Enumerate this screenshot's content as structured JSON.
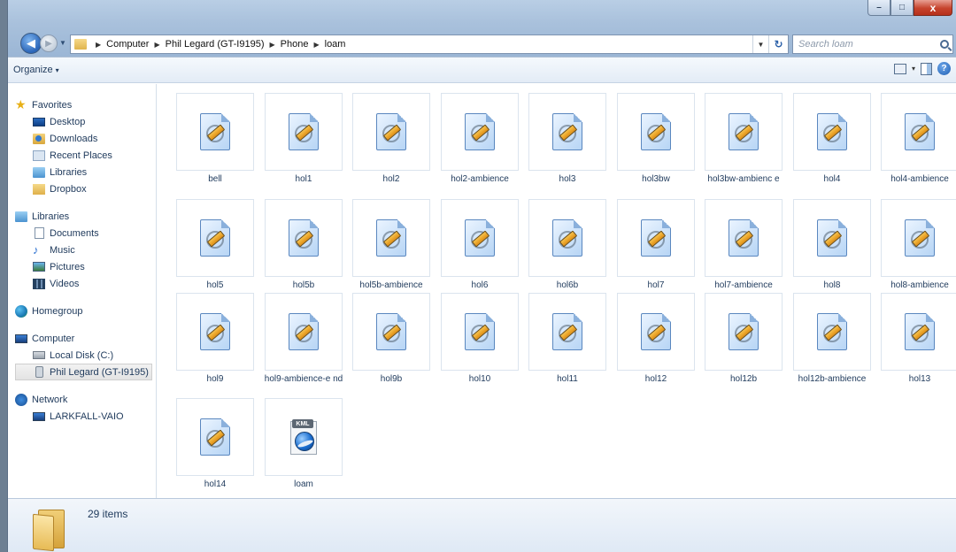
{
  "window": {
    "min_label": "–",
    "max_label": "□",
    "close_label": "x"
  },
  "nav": {
    "back_glyph": "◀",
    "fwd_glyph": "▶",
    "dropdown_glyph": "▼"
  },
  "address": {
    "breadcrumbs": [
      "Computer",
      "Phil Legard (GT-I9195)",
      "Phone",
      "loam"
    ],
    "separator": "▶",
    "dropdown_glyph": "▼",
    "refresh_glyph": "↻"
  },
  "search": {
    "placeholder": "Search loam"
  },
  "toolbar": {
    "organize_label": "Organize",
    "organize_arrow": "▾",
    "view_dd_glyph": "▾",
    "help_label": "?"
  },
  "sidebar": {
    "favorites": {
      "label": "Favorites",
      "items": [
        {
          "label": "Desktop",
          "icon": "desktop-icon"
        },
        {
          "label": "Downloads",
          "icon": "downloads-icon"
        },
        {
          "label": "Recent Places",
          "icon": "recent-places-icon"
        },
        {
          "label": "Libraries",
          "icon": "libraries-icon"
        },
        {
          "label": "Dropbox",
          "icon": "dropbox-icon"
        }
      ]
    },
    "libraries": {
      "label": "Libraries",
      "items": [
        {
          "label": "Documents",
          "icon": "documents-icon"
        },
        {
          "label": "Music",
          "icon": "music-icon"
        },
        {
          "label": "Pictures",
          "icon": "pictures-icon"
        },
        {
          "label": "Videos",
          "icon": "videos-icon"
        }
      ]
    },
    "homegroup": {
      "label": "Homegroup"
    },
    "computer": {
      "label": "Computer",
      "items": [
        {
          "label": "Local Disk (C:)",
          "icon": "disk-icon"
        },
        {
          "label": "Phil Legard (GT-I9195)",
          "icon": "phone-icon",
          "selected": true
        }
      ]
    },
    "network": {
      "label": "Network",
      "items": [
        {
          "label": "LARKFALL-VAIO",
          "icon": "computer-icon"
        }
      ]
    }
  },
  "files": [
    {
      "name": "bell",
      "type": "audio"
    },
    {
      "name": "hol1",
      "type": "audio"
    },
    {
      "name": "hol2",
      "type": "audio"
    },
    {
      "name": "hol2-ambience",
      "type": "audio"
    },
    {
      "name": "hol3",
      "type": "audio"
    },
    {
      "name": "hol3bw",
      "type": "audio"
    },
    {
      "name": "hol3bw-ambienc e",
      "type": "audio"
    },
    {
      "name": "hol4",
      "type": "audio"
    },
    {
      "name": "hol4-ambience",
      "type": "audio"
    },
    {
      "name": "hol5",
      "type": "audio"
    },
    {
      "name": "hol5b",
      "type": "audio"
    },
    {
      "name": "hol5b-ambience",
      "type": "audio"
    },
    {
      "name": "hol6",
      "type": "audio"
    },
    {
      "name": "hol6b",
      "type": "audio"
    },
    {
      "name": "hol7",
      "type": "audio"
    },
    {
      "name": "hol7-ambience",
      "type": "audio"
    },
    {
      "name": "hol8",
      "type": "audio"
    },
    {
      "name": "hol8-ambience",
      "type": "audio"
    },
    {
      "name": "hol9",
      "type": "audio"
    },
    {
      "name": "hol9-ambience-e nd",
      "type": "audio"
    },
    {
      "name": "hol9b",
      "type": "audio"
    },
    {
      "name": "hol10",
      "type": "audio"
    },
    {
      "name": "hol11",
      "type": "audio"
    },
    {
      "name": "hol12",
      "type": "audio"
    },
    {
      "name": "hol12b",
      "type": "audio"
    },
    {
      "name": "hol12b-ambience",
      "type": "audio"
    },
    {
      "name": "hol13",
      "type": "audio"
    },
    {
      "name": "hol14",
      "type": "audio"
    },
    {
      "name": "loam",
      "type": "kml",
      "badge": "KML"
    }
  ],
  "details": {
    "item_count": "29 items"
  }
}
